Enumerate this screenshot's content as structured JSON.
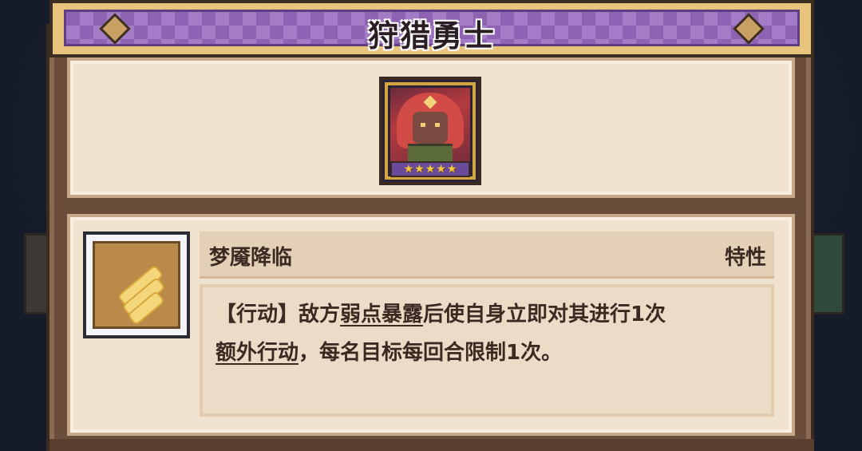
{
  "title": "狩猎勇士",
  "hero": {
    "portrait_icon": "hero-portrait",
    "stars": [
      "★",
      "★",
      "★",
      "★",
      "★"
    ],
    "star_count": 5
  },
  "skill": {
    "icon": "wing-icon",
    "name": "梦魇降临",
    "type": "特性",
    "description": {
      "line1_pre": "【行动】敌方",
      "line1_keyword": "弱点暴露",
      "line1_post": "后使自身立即对其进行1次",
      "line2_keyword": "额外行动",
      "line2_post": "，每名目标每回合限制1次。"
    }
  },
  "colors": {
    "banner_purple": "#8f63b4",
    "panel_bg": "#efe2cf",
    "frame_brown": "#6b4d3b",
    "star_gold": "#f4c842"
  }
}
